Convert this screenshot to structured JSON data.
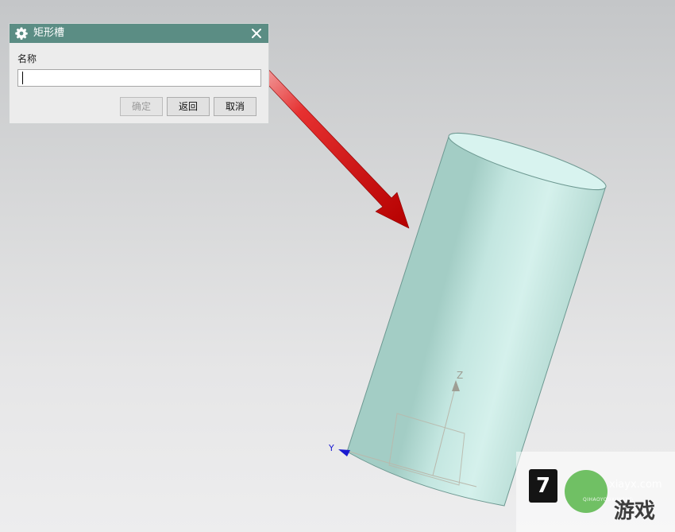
{
  "dialog": {
    "title": "矩形槽",
    "field_label": "名称",
    "field_value": "",
    "buttons": {
      "ok": "确定",
      "back": "返回",
      "cancel": "取消"
    },
    "ok_enabled": false,
    "titlebar_color": "#5b8d84"
  },
  "viewport": {
    "axis_labels": {
      "z": "Z",
      "y": "Y"
    },
    "cylinder_color": "#bde3dd",
    "arrow_color": "#e01010"
  },
  "watermark": {
    "badge": "7",
    "url": "xiayx.com",
    "pinyin": "QIHAOYOUXIWANG",
    "text": "游戏"
  }
}
